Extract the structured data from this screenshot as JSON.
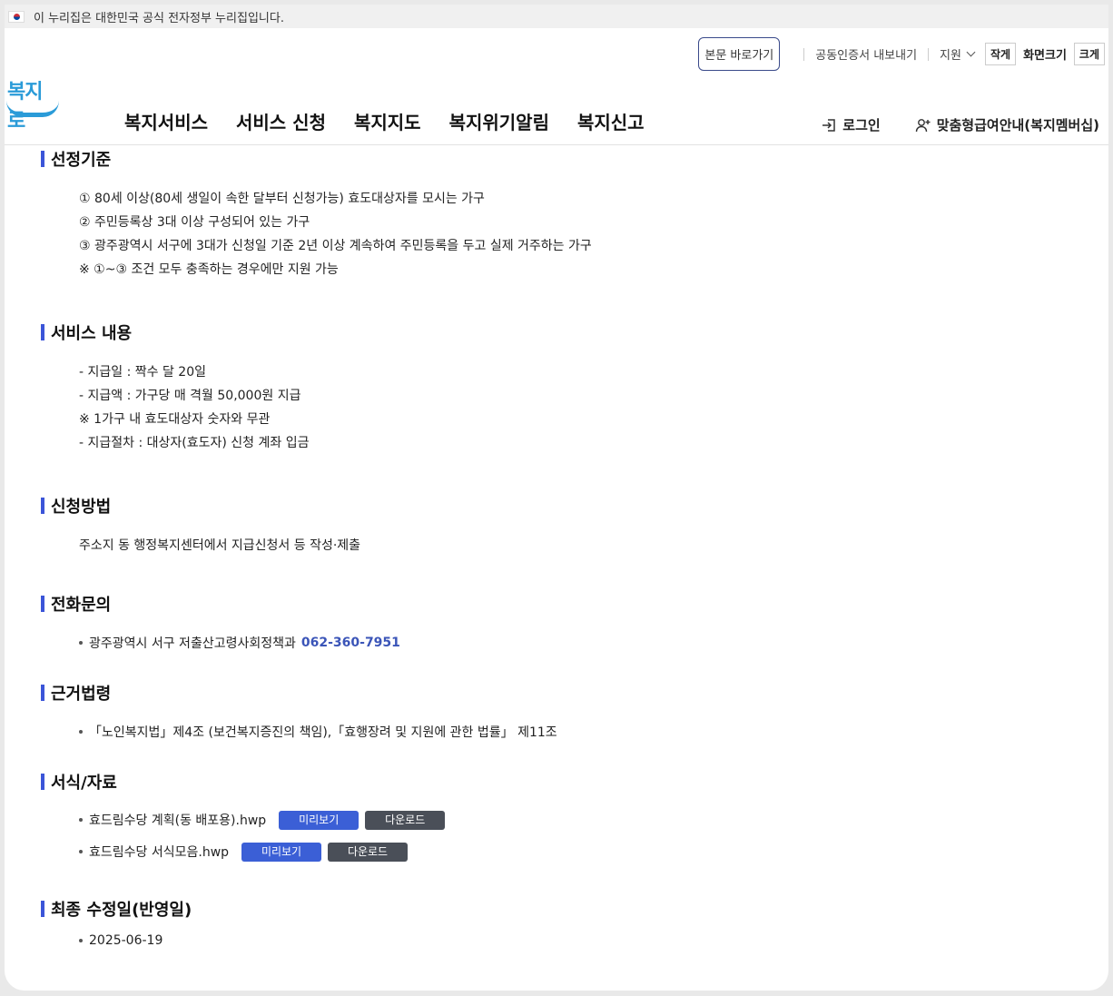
{
  "gov_banner": {
    "text": "이 누리집은 대한민국 공식 전자정부 누리집입니다."
  },
  "header": {
    "skip_link": "본문 바로가기",
    "cert_export": "공동인증서 내보내기",
    "support": "지원",
    "zoom_small": "작게",
    "zoom_label": "화면크기",
    "zoom_large": "크게",
    "logo_text": "복지로",
    "gnb": [
      "복지서비스",
      "서비스 신청",
      "복지지도",
      "복지위기알림",
      "복지신고"
    ],
    "login": "로그인",
    "member_info": "맞춤형급여안내(복지멤버십)"
  },
  "sections": {
    "criteria": {
      "title": "선정기준",
      "lines": [
        "① 80세 이상(80세 생일이 속한 달부터 신청가능) 효도대상자를 모시는 가구",
        "② 주민등록상 3대 이상 구성되어 있는 가구",
        "③ 광주광역시 서구에 3대가 신청일 기준 2년 이상 계속하여 주민등록을 두고 실제 거주하는 가구",
        "※ ①~③ 조건 모두 충족하는 경우에만 지원 가능"
      ]
    },
    "service": {
      "title": "서비스 내용",
      "lines": [
        "- 지급일 : 짝수 달 20일",
        "- 지급액 : 가구당 매 격월 50,000원 지급",
        "※ 1가구 내 효도대상자 숫자와 무관",
        "- 지급절차 : 대상자(효도자) 신청 계좌 입금"
      ]
    },
    "apply": {
      "title": "신청방법",
      "text": "주소지 동 행정복지센터에서 지급신청서 등 작성·제출"
    },
    "phone": {
      "title": "전화문의",
      "org": "광주광역시 서구 저출산고령사회정책과",
      "number": "062-360-7951"
    },
    "law": {
      "title": "근거법령",
      "text": "「노인복지법」제4조 (보건복지증진의 책임),「효행장려 및 지원에 관한 법률」 제11조"
    },
    "forms": {
      "title": "서식/자료",
      "preview_label": "미리보기",
      "download_label": "다운로드",
      "files": [
        "효드림수당 계획(동 배포용).hwp",
        "효드림수당 서식모음.hwp"
      ]
    },
    "modified": {
      "title": "최종 수정일(반영일)",
      "date": "2025-06-19"
    }
  }
}
